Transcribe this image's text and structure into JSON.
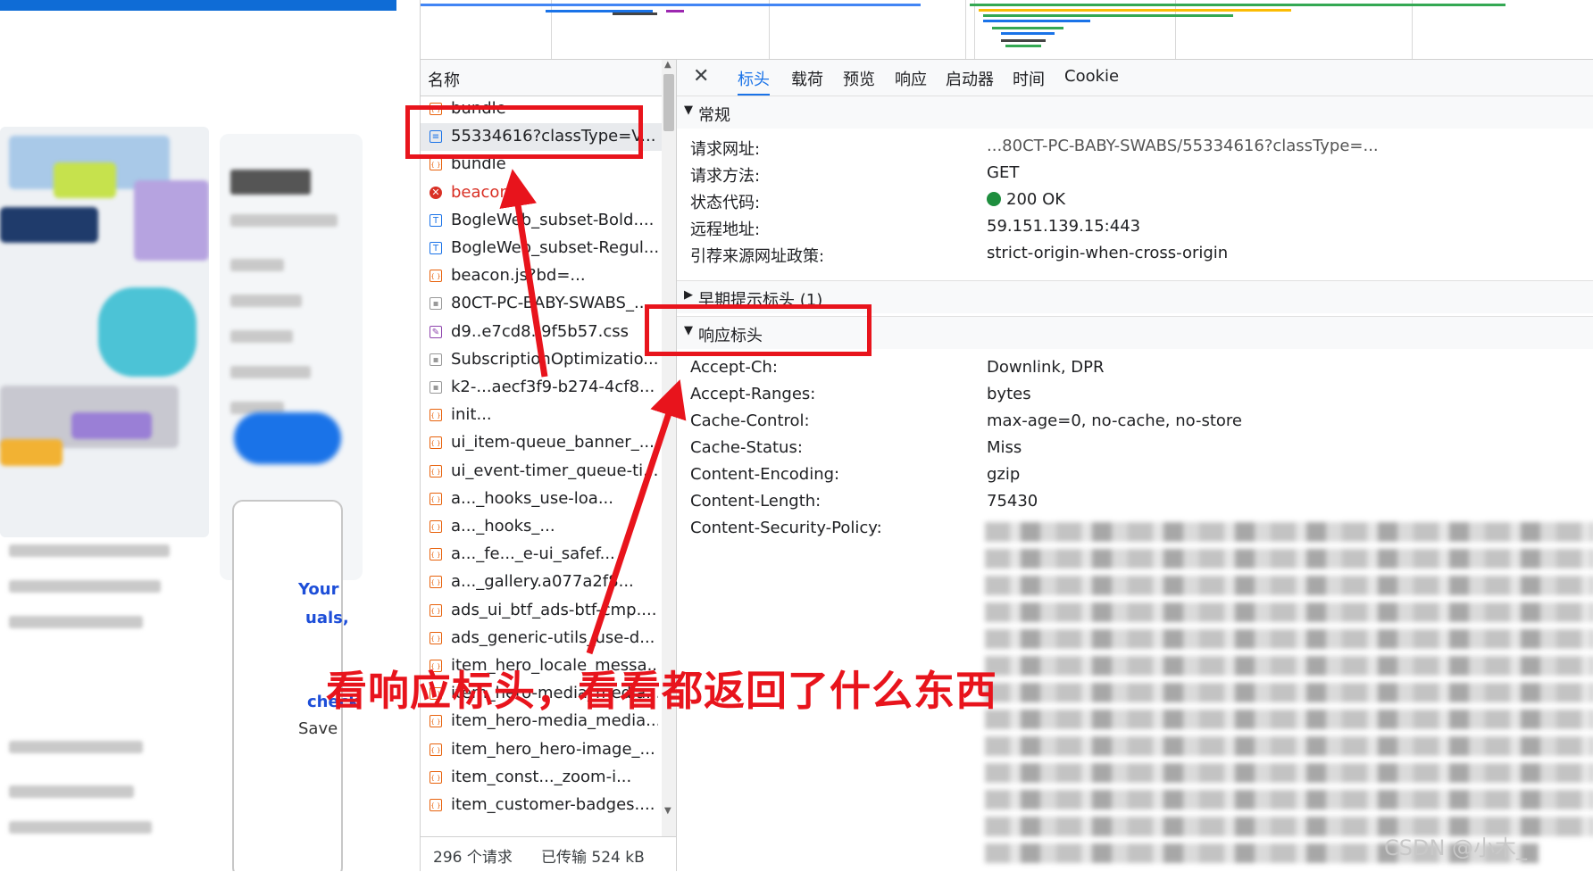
{
  "webpage": {
    "snippets": [
      "Your",
      "uals,",
      "Save",
      "check"
    ]
  },
  "request_list": {
    "header": "名称",
    "rows": [
      {
        "name": "bundle",
        "icon": "script-icon",
        "kind": "js"
      },
      {
        "name": "55334616?classType=V...",
        "icon": "document-icon",
        "kind": "doc",
        "selected": true
      },
      {
        "name": "bundle",
        "icon": "script-icon",
        "kind": "js"
      },
      {
        "name": "beacon",
        "icon": "error-icon",
        "kind": "error"
      },
      {
        "name": "BogleWeb_subset-Bold....",
        "icon": "font-icon",
        "kind": "font"
      },
      {
        "name": "BogleWeb_subset-Regul...",
        "icon": "font-icon",
        "kind": "font"
      },
      {
        "name": "beacon.js?bd=...",
        "icon": "script-icon",
        "kind": "js"
      },
      {
        "name": "80CT-PC-BABY-SWABS_...",
        "icon": "image-icon",
        "kind": "img"
      },
      {
        "name": "d9..e7cd8..9f5b57.css",
        "icon": "stylesheet-icon",
        "kind": "css"
      },
      {
        "name": "SubscriptionOptimizatio...",
        "icon": "image-icon",
        "kind": "img"
      },
      {
        "name": "k2-...aecf3f9-b274-4cf8...",
        "icon": "image-icon",
        "kind": "img"
      },
      {
        "name": "init...",
        "icon": "script-icon",
        "kind": "js"
      },
      {
        "name": "ui_item-queue_banner_...",
        "icon": "script-icon",
        "kind": "js"
      },
      {
        "name": "ui_event-timer_queue-ti...",
        "icon": "script-icon",
        "kind": "js"
      },
      {
        "name": "a..._hooks_use-loa...",
        "icon": "script-icon",
        "kind": "js"
      },
      {
        "name": "a..._hooks_...",
        "icon": "script-icon",
        "kind": "js"
      },
      {
        "name": "a..._fe..._e-ui_safef...",
        "icon": "script-icon",
        "kind": "js"
      },
      {
        "name": "a..._gallery.a077a2f8...",
        "icon": "script-icon",
        "kind": "js"
      },
      {
        "name": "ads_ui_btf_ads-btf-cmp....",
        "icon": "script-icon",
        "kind": "js"
      },
      {
        "name": "ads_generic-utils_use-d...",
        "icon": "script-icon",
        "kind": "js"
      },
      {
        "name": "item_hero_locale_messa...",
        "icon": "script-icon",
        "kind": "js"
      },
      {
        "name": "item_hero-media_media...",
        "icon": "script-icon",
        "kind": "js"
      },
      {
        "name": "item_hero-media_media...",
        "icon": "script-icon",
        "kind": "js"
      },
      {
        "name": "item_hero_hero-image_...",
        "icon": "script-icon",
        "kind": "js"
      },
      {
        "name": "item_const..._zoom-i...",
        "icon": "script-icon",
        "kind": "js"
      },
      {
        "name": "item_customer-badges....",
        "icon": "script-icon",
        "kind": "js"
      }
    ],
    "status": {
      "requests": "296 个请求",
      "transferred": "已传输 524 kB"
    }
  },
  "details": {
    "tabs": [
      "标头",
      "载荷",
      "预览",
      "响应",
      "启动器",
      "时间",
      "Cookie"
    ],
    "active_tab": "标头",
    "general": {
      "title": "常规",
      "rows": [
        {
          "key": "请求网址:",
          "value": "...80CT-PC-BABY-SWABS/55334616?classType=..."
        },
        {
          "key": "请求方法:",
          "value": "GET"
        },
        {
          "key": "状态代码:",
          "value": "200 OK"
        },
        {
          "key": "远程地址:",
          "value": "59.151.139.15:443"
        },
        {
          "key": "引荐来源网址政策:",
          "value": "strict-origin-when-cross-origin"
        }
      ]
    },
    "early_hints": {
      "title": "早期提示标头 (1)"
    },
    "response_headers": {
      "title": "响应标头",
      "rows": [
        {
          "key": "Accept-Ch:",
          "value": "Downlink, DPR"
        },
        {
          "key": "Accept-Ranges:",
          "value": "bytes"
        },
        {
          "key": "Cache-Control:",
          "value": "max-age=0, no-cache, no-store"
        },
        {
          "key": "Cache-Status:",
          "value": "Miss"
        },
        {
          "key": "Content-Encoding:",
          "value": "gzip"
        },
        {
          "key": "Content-Length:",
          "value": "75430"
        },
        {
          "key": "Content-Security-Policy:",
          "value": ""
        }
      ]
    }
  },
  "annotation": {
    "text": "看响应标头，看看都返回了什么东西",
    "color": "#e8141c"
  },
  "watermark": "CSDN @小木_"
}
